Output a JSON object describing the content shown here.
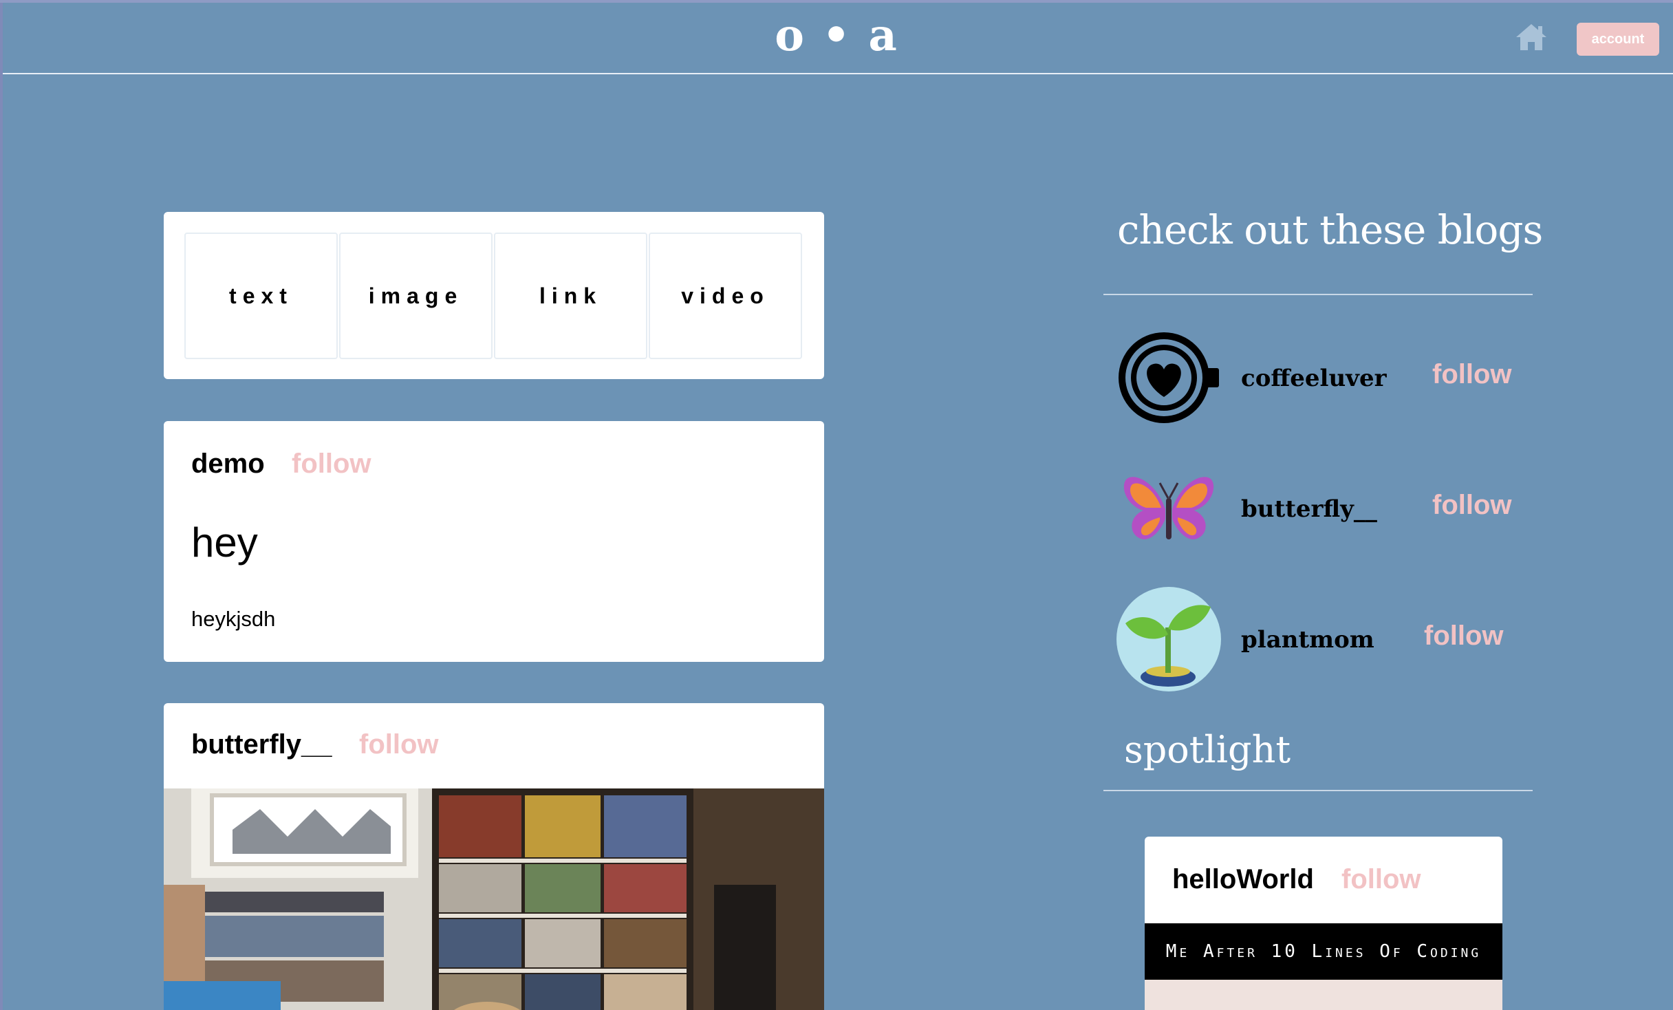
{
  "header": {
    "logo": "o • a",
    "account_label": "account"
  },
  "composer": {
    "types": [
      "text",
      "image",
      "link",
      "video"
    ]
  },
  "posts": [
    {
      "author": "demo",
      "follow_label": "follow",
      "title": "hey",
      "body": "heykjsdh"
    },
    {
      "author": "butterfly__",
      "follow_label": "follow"
    }
  ],
  "sidebar": {
    "title": "check out these blogs",
    "blogs": [
      {
        "name": "coffeeluver",
        "follow_label": "follow",
        "icon": "coffee-heart-icon"
      },
      {
        "name": "butterfly__",
        "follow_label": "follow",
        "icon": "butterfly-icon"
      },
      {
        "name": "plantmom",
        "follow_label": "follow",
        "icon": "sprout-icon"
      }
    ],
    "spotlight_title": "spotlight",
    "spotlight": {
      "author": "helloWorld",
      "follow_label": "follow",
      "banner_text": "Me After 10 Lines Of Coding"
    }
  },
  "colors": {
    "background": "#6c93b5",
    "accent_pink": "#f2c2c4",
    "card": "#ffffff"
  }
}
